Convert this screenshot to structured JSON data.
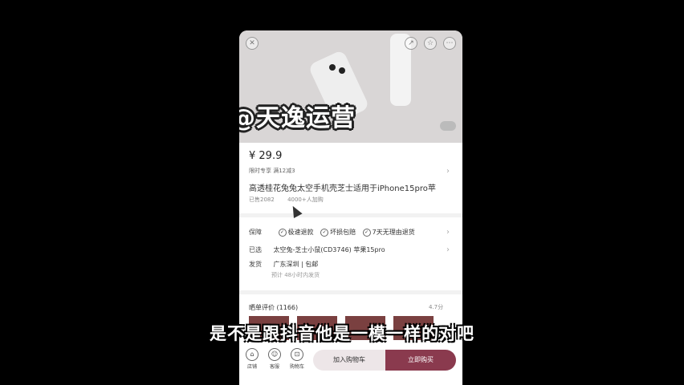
{
  "banner": {
    "watermark": "@天逸运营",
    "close_icon": "close-icon",
    "top_icons": [
      "share-icon",
      "star-icon",
      "more-icon"
    ]
  },
  "product": {
    "price": "¥ 29.9",
    "promo": "限时专享  满12减3",
    "title": "高透桂花兔兔太空手机壳芝士适用于iPhone15pro苹",
    "sold": "已售2082",
    "added": "4000+人加购"
  },
  "details": {
    "guarantee_label": "保障",
    "guarantees": [
      "极速退款",
      "坏损包赔",
      "7天无理由退货"
    ],
    "selected_label": "已选",
    "selected_value": "太空兔-芝士小鼠(CD3746) 苹果15pro",
    "ship_label": "发货",
    "ship_value": "广东深圳 | 包邮",
    "ship_sub": "预计  48小时内发货"
  },
  "reviews": {
    "label": "晒单评价 (1166)",
    "rating": "4.7分"
  },
  "bottom_bar": {
    "nav": [
      {
        "label": "店铺",
        "icon": "store-icon"
      },
      {
        "label": "客服",
        "icon": "service-icon"
      },
      {
        "label": "购物车",
        "icon": "cart-icon"
      }
    ],
    "add_to_cart": "加入购物车",
    "buy_now": "立即购买"
  },
  "subtitle": "是不是跟抖音他是一模一样的对吧",
  "colors": {
    "accent": "#8a3a4e",
    "cart_button_bg": "#ede6e8"
  }
}
